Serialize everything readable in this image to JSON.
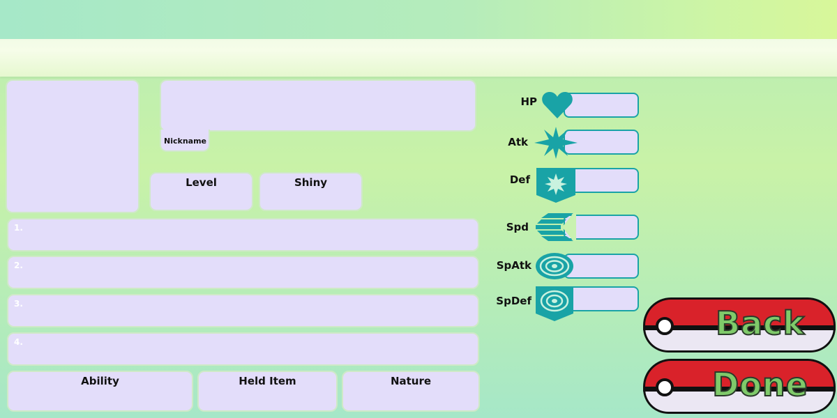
{
  "header": {
    "title": ""
  },
  "form": {
    "nickname_label": "Nickname",
    "level_label": "Level",
    "shiny_label": "Shiny",
    "moves": [
      "1.",
      "2.",
      "3.",
      "4."
    ],
    "ability_label": "Ability",
    "held_item_label": "Held Item",
    "nature_label": "Nature"
  },
  "stats": [
    {
      "label": "HP",
      "icon": "heart-icon"
    },
    {
      "label": "Atk",
      "icon": "burst-icon"
    },
    {
      "label": "Def",
      "icon": "shield-icon"
    },
    {
      "label": "Spd",
      "icon": "chevrons-icon"
    },
    {
      "label": "SpAtk",
      "icon": "target-icon"
    },
    {
      "label": "SpDef",
      "icon": "shield-target-icon"
    }
  ],
  "buttons": {
    "back": "Back",
    "done": "Done"
  },
  "colors": {
    "accent": "#19a3a6",
    "field": "#e3ddfa",
    "pokeball_red": "#d9222a",
    "button_text": "#7fca6a"
  }
}
